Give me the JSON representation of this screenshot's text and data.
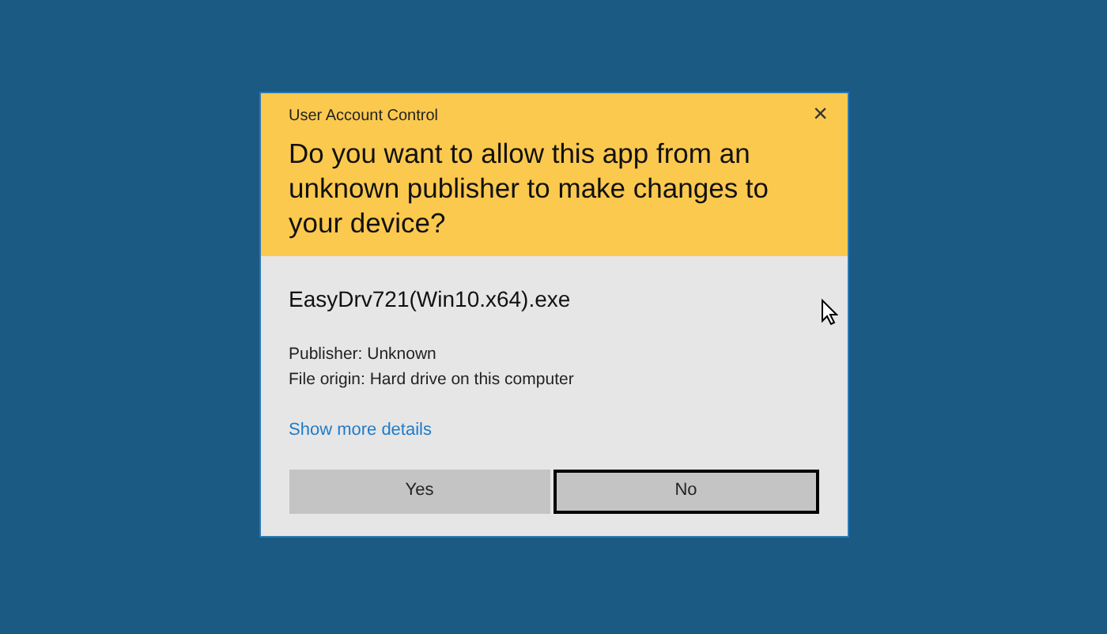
{
  "window": {
    "title": "User Account Control",
    "close": "×"
  },
  "question": "Do you want to allow this app from an unknown publisher to make changes to your device?",
  "program": "EasyDrv721(Win10.x64).exe",
  "details": [
    "Publisher: Unknown",
    "File origin: Hard drive on this computer"
  ],
  "link": "Show more details",
  "buttons": [
    {
      "label": "Yes",
      "focused": false
    },
    {
      "label": "No",
      "focused": true
    }
  ]
}
